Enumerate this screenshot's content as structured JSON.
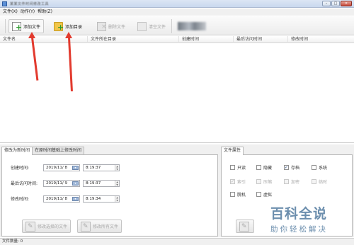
{
  "window": {
    "title": "某某文件时间修改工具",
    "controls": {
      "minimize": "–",
      "maximize": "□",
      "close": "×"
    }
  },
  "menu": [
    "文件(X)",
    "动作(Y)",
    "帮助(Z)"
  ],
  "toolbar": {
    "add_file": "添加文件",
    "add_folder": "添加目录",
    "remove_file": "删除文件",
    "clear_list": "清空文件"
  },
  "file_table": {
    "columns": [
      "文件名",
      "文件所在目录",
      "创建时间",
      "最后访问时间",
      "修改时间"
    ]
  },
  "time_panel": {
    "tabs": [
      "修改为新时间",
      "在原时间基础上修改时间"
    ],
    "rows": [
      {
        "label": "创建时间:",
        "date": "2019/11/ 8",
        "time": "8:19:37"
      },
      {
        "label": "最后访问时间:",
        "date": "2019/11/ 9",
        "time": "8:19:37"
      },
      {
        "label": "修改时间:",
        "date": "2019/11/ 8",
        "time": "8:19:34"
      }
    ],
    "buttons": {
      "modify_selected": "修改选择的文件",
      "modify_all": "修改所有文件"
    }
  },
  "attr_panel": {
    "tab": "文件属性",
    "attributes": [
      {
        "label": "只读",
        "checked": false,
        "disabled": false
      },
      {
        "label": "隐藏",
        "checked": false,
        "disabled": false
      },
      {
        "label": "存档",
        "checked": true,
        "disabled": false
      },
      {
        "label": "系统",
        "checked": false,
        "disabled": false
      },
      {
        "label": "索引",
        "checked": true,
        "disabled": true
      },
      {
        "label": "压缩",
        "checked": false,
        "disabled": true
      },
      {
        "label": "加密",
        "checked": false,
        "disabled": true
      },
      {
        "label": "临时",
        "checked": false,
        "disabled": true
      },
      {
        "label": "脱机",
        "checked": false,
        "disabled": false
      },
      {
        "label": "虚拟",
        "checked": false,
        "disabled": false
      }
    ]
  },
  "status": {
    "label": "文件数量:",
    "count": "0"
  },
  "annotations": {
    "arrow_color": "#e23a2e"
  },
  "watermark": {
    "line1": "百科全说",
    "line2": "助你轻松解决",
    "color": "#6d8fae"
  }
}
